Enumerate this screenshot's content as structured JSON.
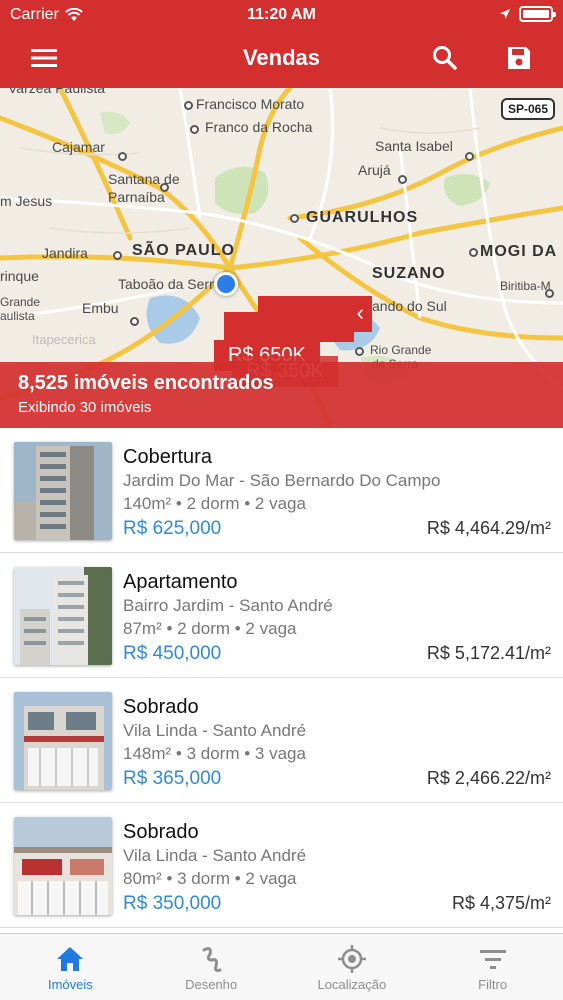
{
  "status_bar": {
    "carrier": "Carrier",
    "time": "11:20 AM"
  },
  "nav": {
    "title": "Vendas",
    "menu_icon": "menu-icon",
    "search_icon": "search-icon",
    "save_icon": "save-icon"
  },
  "map": {
    "labels": {
      "varzea": "Varzea Paulista",
      "francisco_morato": "Francisco Morato",
      "franco_da_rocha": "Franco da Rocha",
      "cajamar": "Cajamar",
      "santa_isabel": "Santa Isabel",
      "santana": "Santana de",
      "parnaiba": "Parnaíba",
      "jesus": "m Jesus",
      "aruja": "Arujá",
      "guarulhos": "GUARULHOS",
      "jandira": "Jandira",
      "sao_paulo": "SÃO PAULO",
      "mogi": "MOGI DA",
      "rinque": "rinque",
      "taboao": "Taboão da Serra",
      "suzano": "SUZANO",
      "biritiba": "Biritiba-M",
      "grande": "Grande",
      "aulista": "aulista",
      "embu": "Embu",
      "ando_do_sul": "ando do Sul",
      "rio_grande": "Rio Grande",
      "da_serra": "da Serra",
      "itapecerica": "Itapecerica"
    },
    "highway_badge": "SP-065",
    "markers": [
      "R$ 650K",
      "R$ 350K"
    ],
    "banner_title": "8,525 imóveis encontrados",
    "banner_subtitle": "Exibindo 30 imóveis"
  },
  "listings": [
    {
      "title": "Cobertura",
      "location": "Jardim Do Mar - São Bernardo Do Campo",
      "specs": "140m² • 2 dorm • 2 vaga",
      "price": "R$ 625,000",
      "price_per_m2": "R$ 4,464.29/m²"
    },
    {
      "title": "Apartamento",
      "location": "Bairro Jardim - Santo André",
      "specs": "87m² • 2 dorm • 2 vaga",
      "price": "R$ 450,000",
      "price_per_m2": "R$ 5,172.41/m²"
    },
    {
      "title": "Sobrado",
      "location": "Vila Linda - Santo André",
      "specs": "148m² • 3 dorm • 3 vaga",
      "price": "R$ 365,000",
      "price_per_m2": "R$ 2,466.22/m²"
    },
    {
      "title": "Sobrado",
      "location": "Vila Linda - Santo André",
      "specs": "80m² • 3 dorm • 2 vaga",
      "price": "R$ 350,000",
      "price_per_m2": "R$ 4,375/m²"
    }
  ],
  "tabs": [
    {
      "label": "Imóveis",
      "icon": "home-icon",
      "active": true
    },
    {
      "label": "Desenho",
      "icon": "draw-icon",
      "active": false
    },
    {
      "label": "Localização",
      "icon": "location-target-icon",
      "active": false
    },
    {
      "label": "Filtro",
      "icon": "filter-icon",
      "active": false
    }
  ],
  "colors": {
    "brand": "#d32f2f",
    "price": "#2f8ad8",
    "active_tab": "#1f7be0"
  }
}
